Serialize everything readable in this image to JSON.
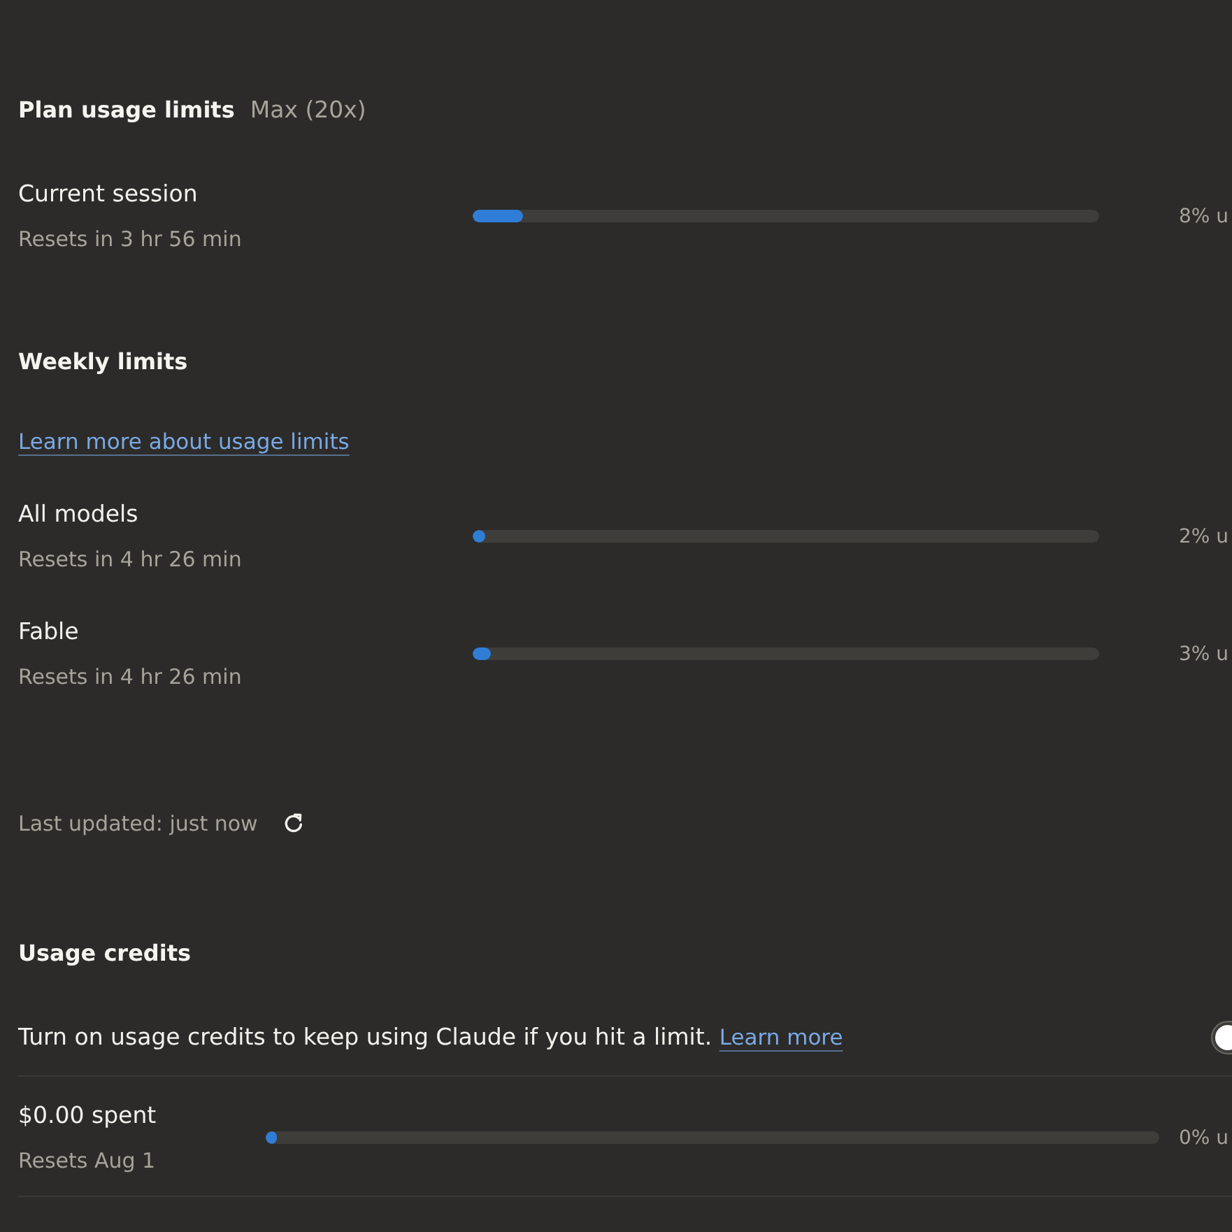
{
  "plan": {
    "title": "Plan usage limits",
    "tier": "Max (20x)"
  },
  "session": {
    "label": "Current session",
    "resets": "Resets in 3 hr 56 min",
    "level": 0.08,
    "reading": "8% u"
  },
  "weekly": {
    "title": "Weekly limits",
    "link": "Learn more about usage limits",
    "limits": [
      {
        "label": "All models",
        "resets": "Resets in 4 hr 26 min",
        "level": 0.02,
        "reading": "2% u"
      },
      {
        "label": "Fable",
        "resets": "Resets in 4 hr 26 min",
        "level": 0.03,
        "reading": "3% u"
      }
    ]
  },
  "last_updated": "Last updated: just now",
  "credits": {
    "title": "Usage credits",
    "description": "Turn on usage credits to keep using Claude if you hit a limit.",
    "link": "Learn more",
    "on": false,
    "spent": {
      "label": "$0.00 spent",
      "resets": "Resets Aug 1",
      "level": 0,
      "reading": "0% u"
    }
  }
}
